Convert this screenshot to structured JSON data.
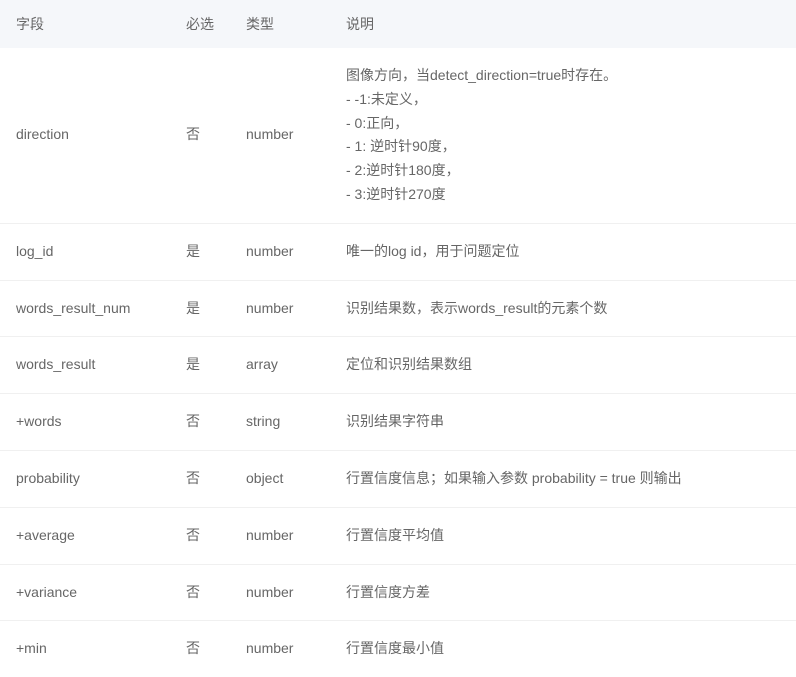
{
  "headers": {
    "field": "字段",
    "required": "必选",
    "type": "类型",
    "description": "说明"
  },
  "rows": [
    {
      "field": "direction",
      "required": "否",
      "type": "number",
      "description": "图像方向，当detect_direction=true时存在。\n- -1:未定义，\n- 0:正向，\n- 1: 逆时针90度，\n- 2:逆时针180度，\n- 3:逆时针270度"
    },
    {
      "field": "log_id",
      "required": "是",
      "type": "number",
      "description": "唯一的log id，用于问题定位"
    },
    {
      "field": "words_result_num",
      "required": "是",
      "type": "number",
      "description": "识别结果数，表示words_result的元素个数"
    },
    {
      "field": "words_result",
      "required": "是",
      "type": "array",
      "description": "定位和识别结果数组"
    },
    {
      "field": "+words",
      "required": "否",
      "type": "string",
      "description": "识别结果字符串"
    },
    {
      "field": "probability",
      "required": "否",
      "type": "object",
      "description": "行置信度信息；如果输入参数 probability = true 则输出"
    },
    {
      "field": "+average",
      "required": "否",
      "type": "number",
      "description": "行置信度平均值"
    },
    {
      "field": "+variance",
      "required": "否",
      "type": "number",
      "description": "行置信度方差"
    },
    {
      "field": "+min",
      "required": "否",
      "type": "number",
      "description": "行置信度最小值"
    }
  ]
}
